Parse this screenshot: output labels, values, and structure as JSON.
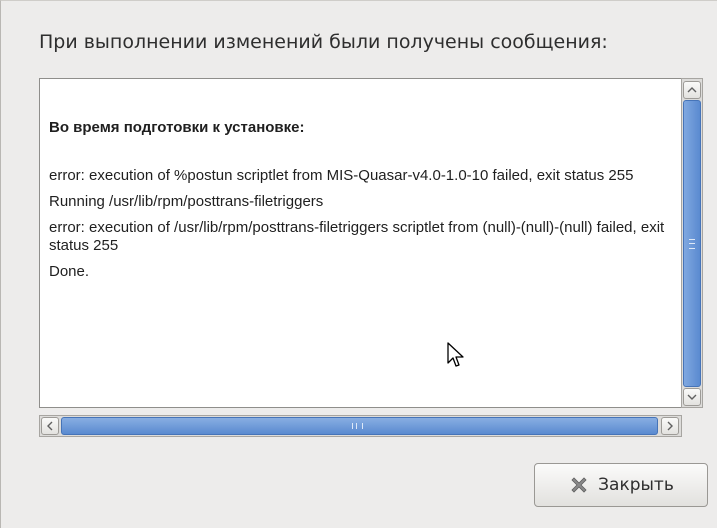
{
  "dialog": {
    "heading": "При выполнении изменений были получены сообщения:"
  },
  "log": {
    "section_title": "Во время подготовки к установке:",
    "lines": [
      "error: execution of %postun scriptlet from MIS-Quasar-v4.0-1.0-10 failed, exit status 255",
      "Running /usr/lib/rpm/posttrans-filetriggers",
      "error: execution of /usr/lib/rpm/posttrans-filetriggers scriptlet from (null)-(null)-(null) failed, exit status 255",
      "Done."
    ]
  },
  "buttons": {
    "close_label": "Закрыть"
  },
  "icons": {
    "close": "close-x-icon",
    "scroll_up": "chevron-up-icon",
    "scroll_down": "chevron-down-icon",
    "scroll_left": "chevron-left-icon",
    "scroll_right": "chevron-right-icon",
    "cursor": "mouse-pointer-icon"
  },
  "colors": {
    "scroll_thumb": "#5a8ad0",
    "dialog_bg": "#edeceb"
  }
}
